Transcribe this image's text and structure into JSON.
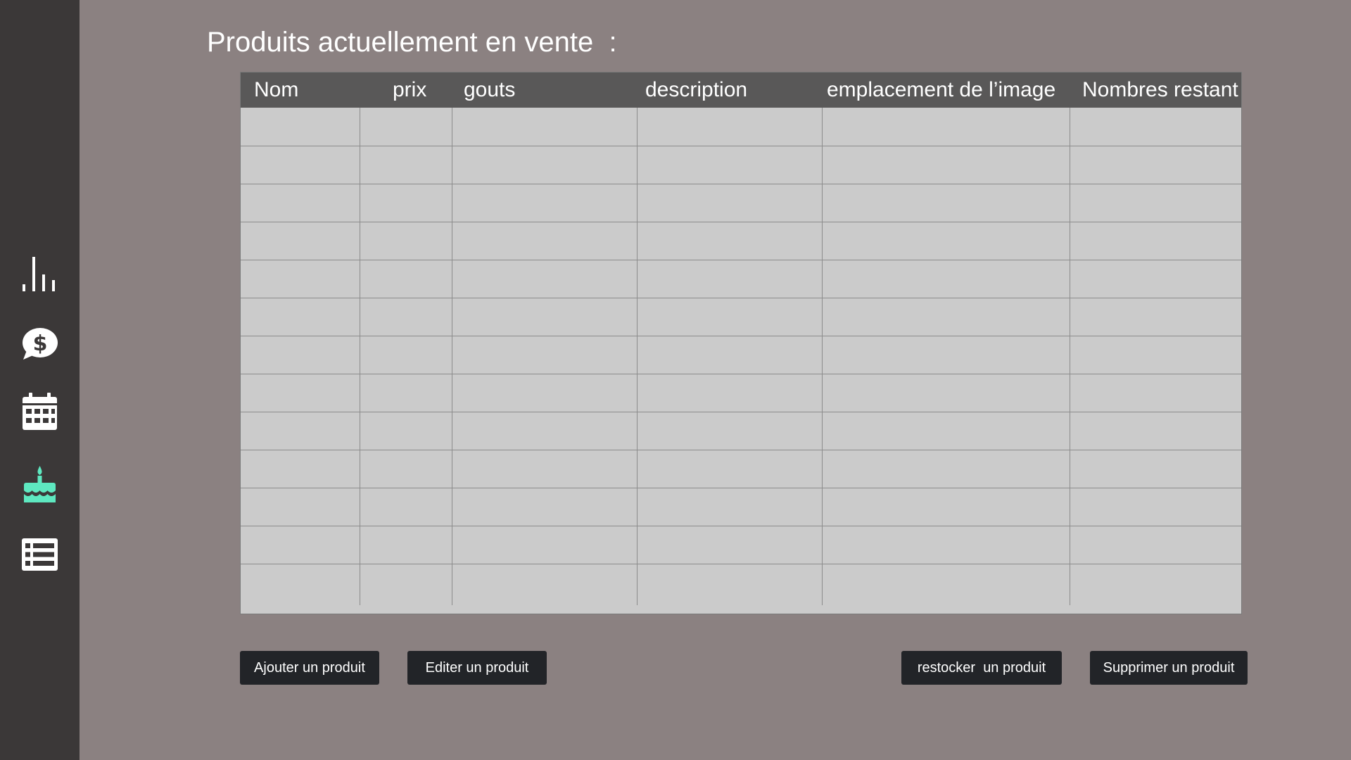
{
  "sidebar": {
    "items": [
      {
        "icon": "bar-chart-icon"
      },
      {
        "icon": "dollar-speech-bubble-icon"
      },
      {
        "icon": "calendar-icon"
      },
      {
        "icon": "birthday-cake-icon",
        "active": true
      },
      {
        "icon": "list-icon"
      }
    ],
    "icon_color": "#ffffff",
    "active_color": "#5ee8c0",
    "background": "#3b3838"
  },
  "page": {
    "title": "Produits actuellement en vente  :"
  },
  "table": {
    "columns": [
      "Nom",
      "prix",
      "gouts",
      "description",
      "emplacement de l’image",
      "Nombres restant"
    ],
    "rows": [
      [
        "",
        "",
        "",
        "",
        "",
        ""
      ],
      [
        "",
        "",
        "",
        "",
        "",
        ""
      ],
      [
        "",
        "",
        "",
        "",
        "",
        ""
      ],
      [
        "",
        "",
        "",
        "",
        "",
        ""
      ],
      [
        "",
        "",
        "",
        "",
        "",
        ""
      ],
      [
        "",
        "",
        "",
        "",
        "",
        ""
      ],
      [
        "",
        "",
        "",
        "",
        "",
        ""
      ],
      [
        "",
        "",
        "",
        "",
        "",
        ""
      ],
      [
        "",
        "",
        "",
        "",
        "",
        ""
      ],
      [
        "",
        "",
        "",
        "",
        "",
        ""
      ],
      [
        "",
        "",
        "",
        "",
        "",
        ""
      ],
      [
        "",
        "",
        "",
        "",
        "",
        ""
      ],
      [
        "",
        "",
        "",
        "",
        "",
        ""
      ]
    ],
    "header_background": "#595858",
    "cell_background": "#cbcbcb"
  },
  "actions": {
    "add_label": "Ajouter un produit",
    "edit_label": "Editer un produit",
    "restock_label": "restocker  un produit",
    "delete_label": "Supprimer un produit"
  },
  "colors": {
    "page_background": "#8b8181",
    "button_background": "#222428"
  }
}
